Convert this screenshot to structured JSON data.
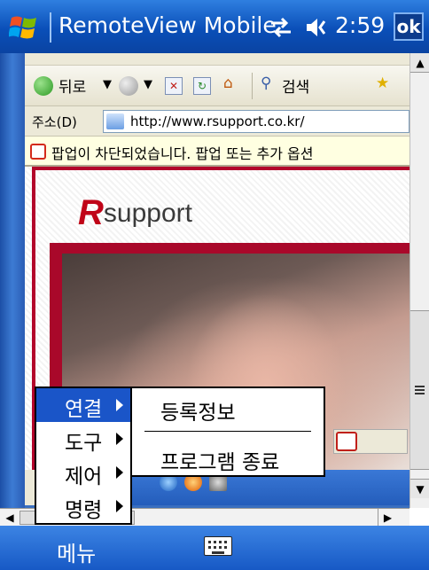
{
  "titlebar": {
    "app_title": "RemoteView Mobile",
    "time": "2:59",
    "ok_label": "ok",
    "icons": [
      "windows-start-icon",
      "connectivity-icon",
      "volume-icon"
    ]
  },
  "ie": {
    "toolbar": {
      "back_label": "뒤로",
      "search_label": "검색"
    },
    "address": {
      "label": "주소(D)",
      "url": "http://www.rsupport.co.kr/"
    },
    "popup_notice": "팝업이 차단되었습니다. 팝업 또는 추가 옵션"
  },
  "page": {
    "logo_mark": "R",
    "logo_text": "support"
  },
  "menu": {
    "main_items": [
      {
        "label": "연결",
        "has_submenu": true,
        "selected": true
      },
      {
        "label": "도구",
        "has_submenu": true,
        "selected": false
      },
      {
        "label": "제어",
        "has_submenu": true,
        "selected": false
      },
      {
        "label": "명령",
        "has_submenu": true,
        "selected": false
      }
    ],
    "submenu_items": [
      {
        "label": "등록정보"
      },
      {
        "label": "프로그램 종료"
      }
    ]
  },
  "cmdbar": {
    "menu_label": "메뉴",
    "keyboard_icon": "keyboard-icon"
  },
  "colors": {
    "titlebar": "#0a4fb8",
    "menu_selected": "#1a55c8",
    "brand_red": "#c00418"
  }
}
